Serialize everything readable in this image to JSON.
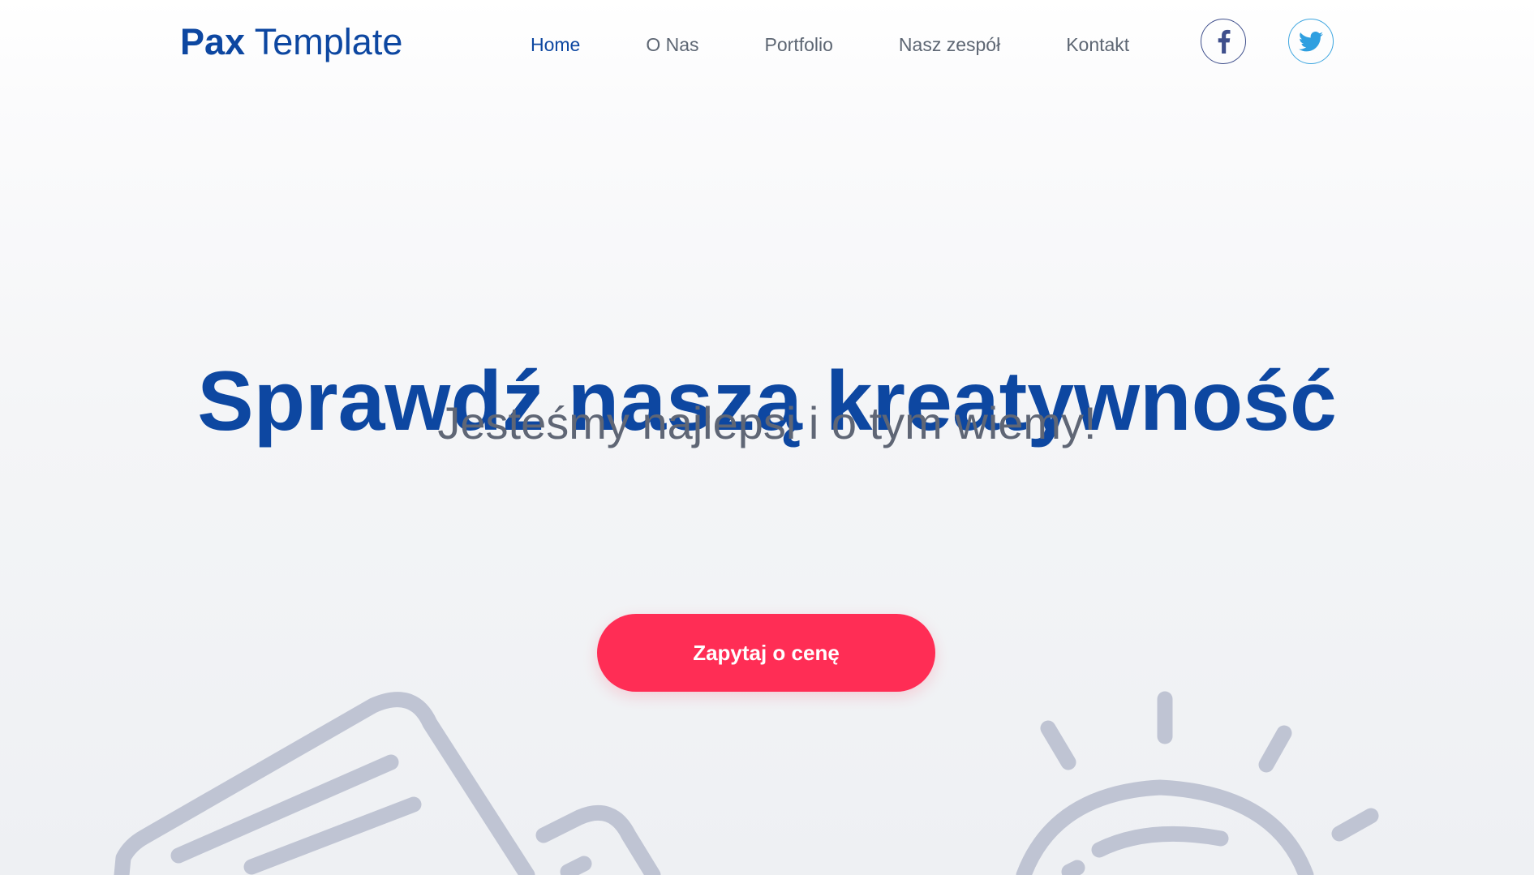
{
  "header": {
    "logo_bold": "Pax",
    "logo_light": " Template",
    "nav": [
      {
        "label": "Home",
        "active": true
      },
      {
        "label": "O Nas",
        "active": false
      },
      {
        "label": "Portfolio",
        "active": false
      },
      {
        "label": "Nasz zespół",
        "active": false
      },
      {
        "label": "Kontakt",
        "active": false
      }
    ],
    "social": [
      {
        "icon": "facebook-icon",
        "color": "#3f4f8c"
      },
      {
        "icon": "twitter-icon",
        "color": "#3ea6e0"
      }
    ]
  },
  "hero": {
    "title": "Sprawdź naszą kreatywność",
    "subtitle": "Jesteśmy najlepsi i o tym wiemy!",
    "cta_label": "Zapytaj o cenę"
  },
  "colors": {
    "brand": "#0d47a1",
    "accent": "#ff2d55",
    "nav_text": "#5d6673",
    "illustration": "#bfc4d3"
  }
}
